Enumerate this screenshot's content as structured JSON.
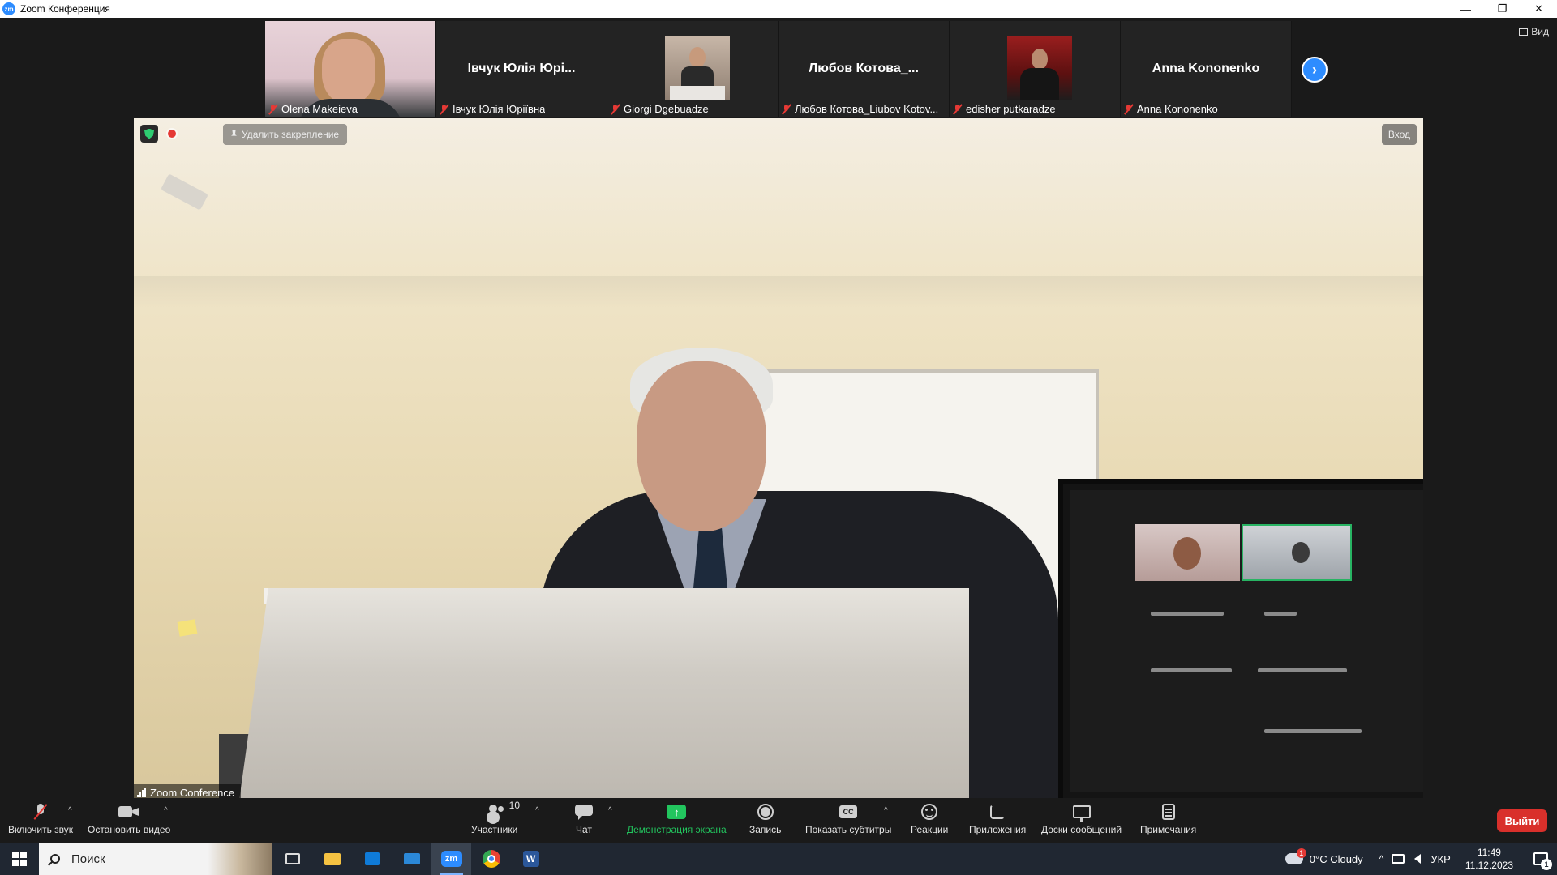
{
  "window": {
    "logo_text": "zm",
    "title": "Zoom Конференция",
    "minimize": "—",
    "restore": "❐",
    "close": "✕"
  },
  "view_button": {
    "label": "Вид"
  },
  "thumbnails": [
    {
      "caption": "Olena Makeieva",
      "display_name": "",
      "has_video": true
    },
    {
      "caption": "Івчук Юлія Юріївна",
      "display_name": "Івчук Юлія Юрі...",
      "has_video": false
    },
    {
      "caption": "Giorgi Dgebuadze",
      "display_name": "",
      "has_video": true
    },
    {
      "caption": "Любов Котова_Liubov Kotov...",
      "display_name": "Любов Котова_...",
      "has_video": false
    },
    {
      "caption": "edisher putkaradze",
      "display_name": "",
      "has_video": true
    },
    {
      "caption": "Anna Kononenko",
      "display_name": "Anna Kononenko",
      "has_video": false
    }
  ],
  "thumb_next": "›",
  "main_video": {
    "unpin_label": "Удалить закрепление",
    "enter_label": "Вход",
    "speaker_label": "Zoom Conference"
  },
  "toolbar": {
    "unmute": "Включить звук",
    "stop_video": "Остановить видео",
    "participants": "Участники",
    "participants_count": "10",
    "chat": "Чат",
    "share_screen": "Демонстрация экрана",
    "share_arrow": "↑",
    "record": "Запись",
    "captions": "Показать субтитры",
    "cc": "CC",
    "reactions": "Реакции",
    "apps": "Приложения",
    "whiteboards": "Доски сообщений",
    "notes": "Примечания",
    "leave": "Выйти",
    "caret": "^"
  },
  "taskbar": {
    "search_placeholder": "Поиск",
    "zoom_icon": "zm",
    "word_icon": "W",
    "weather_badge": "1",
    "weather": "0°C  Cloudy",
    "caret": "^",
    "language": "УКР",
    "time": "11:49",
    "date": "11.12.2023",
    "notification_count": "1"
  },
  "colors": {
    "zoom_blue": "#2d8cff",
    "leave_red": "#d9302b",
    "share_green": "#22c55e",
    "mute_red": "#e53935"
  }
}
